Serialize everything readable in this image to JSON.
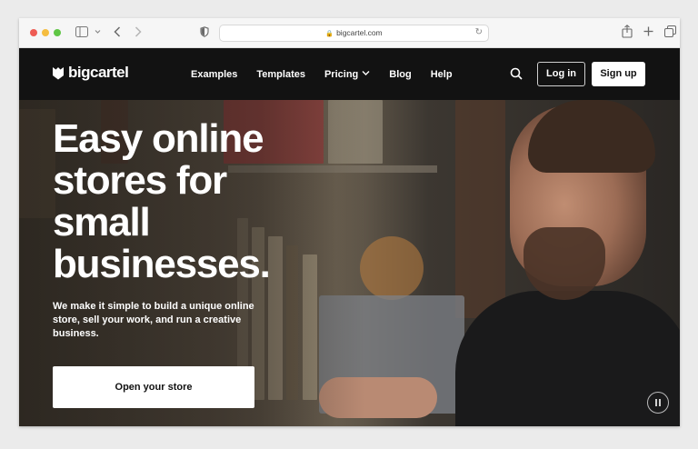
{
  "browser": {
    "url": "bigcartel.com",
    "icons": [
      "close-dot",
      "minimize-dot",
      "zoom-dot",
      "sidebar-icon",
      "chevron-down-icon",
      "back-icon",
      "forward-icon",
      "shield-icon",
      "lock-icon",
      "reload-icon",
      "share-icon",
      "new-tab-icon",
      "tabs-overview-icon"
    ]
  },
  "nav": {
    "logo_text": "bigcartel",
    "links": [
      "Examples",
      "Templates",
      "Pricing",
      "Blog",
      "Help"
    ],
    "login_label": "Log in",
    "signup_label": "Sign up"
  },
  "hero": {
    "headline_lines": [
      "Easy online",
      "stores for",
      "small",
      "businesses."
    ],
    "subcopy": "We make it simple to build a unique online store, sell your work, and run a creative business.",
    "cta_label": "Open your store"
  },
  "colors": {
    "nav_bg": "#121212",
    "button_bg": "#ffffff",
    "text_light": "#ffffff"
  }
}
